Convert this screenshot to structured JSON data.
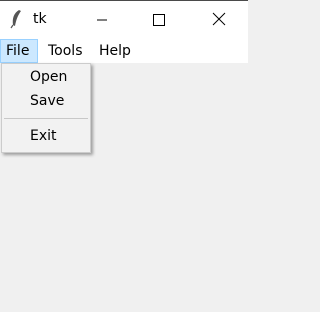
{
  "window": {
    "title": "tk",
    "icon": "feather-icon",
    "controls": [
      "minimize-icon",
      "maximize-icon",
      "close-icon"
    ]
  },
  "menubar": {
    "items": [
      {
        "label": "File",
        "active": true
      },
      {
        "label": "Tools"
      },
      {
        "label": "Help"
      }
    ]
  },
  "file_menu": {
    "items": [
      {
        "label": "Open"
      },
      {
        "label": "Save"
      },
      {
        "label": "Exit"
      }
    ]
  },
  "colors": {
    "menu_highlight": "#cce8ff",
    "menu_highlight_border": "#99d1ff",
    "client_bg": "#f0f0f0"
  }
}
